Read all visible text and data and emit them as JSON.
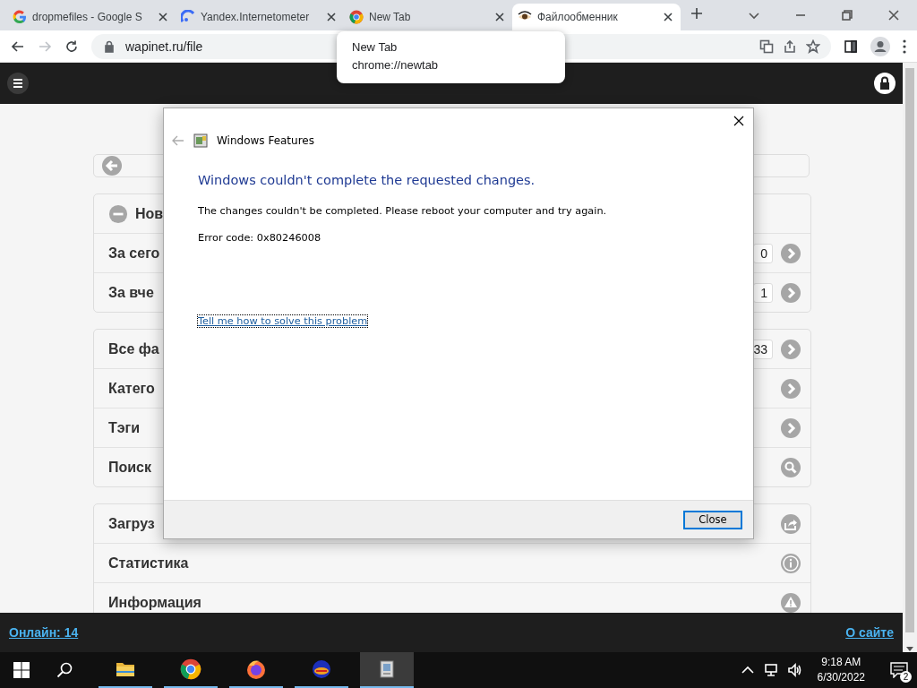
{
  "browser": {
    "tabs": [
      {
        "title": "dropmefiles - Google S",
        "kind": "google",
        "selected": false
      },
      {
        "title": "Yandex.Internetometer",
        "kind": "yandex",
        "selected": false
      },
      {
        "title": "New Tab",
        "kind": "chrome",
        "selected": false
      },
      {
        "title": "Файлообменник",
        "kind": "site",
        "selected": true
      }
    ],
    "tooltip": {
      "title": "New Tab",
      "url": "chrome://newtab"
    },
    "address": "wapinet.ru/file",
    "forward_disabled": true
  },
  "site": {
    "groups": [
      {
        "items": [
          {
            "label": "Нов",
            "kind": "header"
          },
          {
            "label": "За сего",
            "count": "0",
            "kind": "link"
          },
          {
            "label": "За вче",
            "count": "1",
            "kind": "link"
          }
        ]
      },
      {
        "items": [
          {
            "label": "Все фа",
            "count": "33",
            "kind": "link"
          },
          {
            "label": "Катего",
            "kind": "link"
          },
          {
            "label": "Тэги",
            "kind": "link"
          },
          {
            "label": "Поиск",
            "kind": "search"
          }
        ]
      },
      {
        "items": [
          {
            "label": "Загруз",
            "kind": "upload"
          },
          {
            "label": "Статистика",
            "kind": "info"
          },
          {
            "label": "Информация",
            "kind": "warning"
          }
        ]
      }
    ],
    "footer": {
      "online": "Онлайн: 14",
      "about": "О сайте"
    }
  },
  "dialog": {
    "title": "Windows Features",
    "heading": "Windows couldn't complete the requested changes.",
    "message": "The changes couldn't be completed. Please reboot your computer and try again.",
    "error": "Error code: 0x80246008",
    "link": "Tell me how to solve this problem",
    "button": "Close"
  },
  "taskbar": {
    "apps": [
      {
        "kind": "explorer",
        "selected": false
      },
      {
        "kind": "chrome",
        "selected": false
      },
      {
        "kind": "firefox",
        "selected": false
      },
      {
        "kind": "app",
        "selected": false
      },
      {
        "kind": "features",
        "selected": true
      }
    ],
    "time": "9:18 AM",
    "date": "6/30/2022",
    "notifications": "2"
  }
}
